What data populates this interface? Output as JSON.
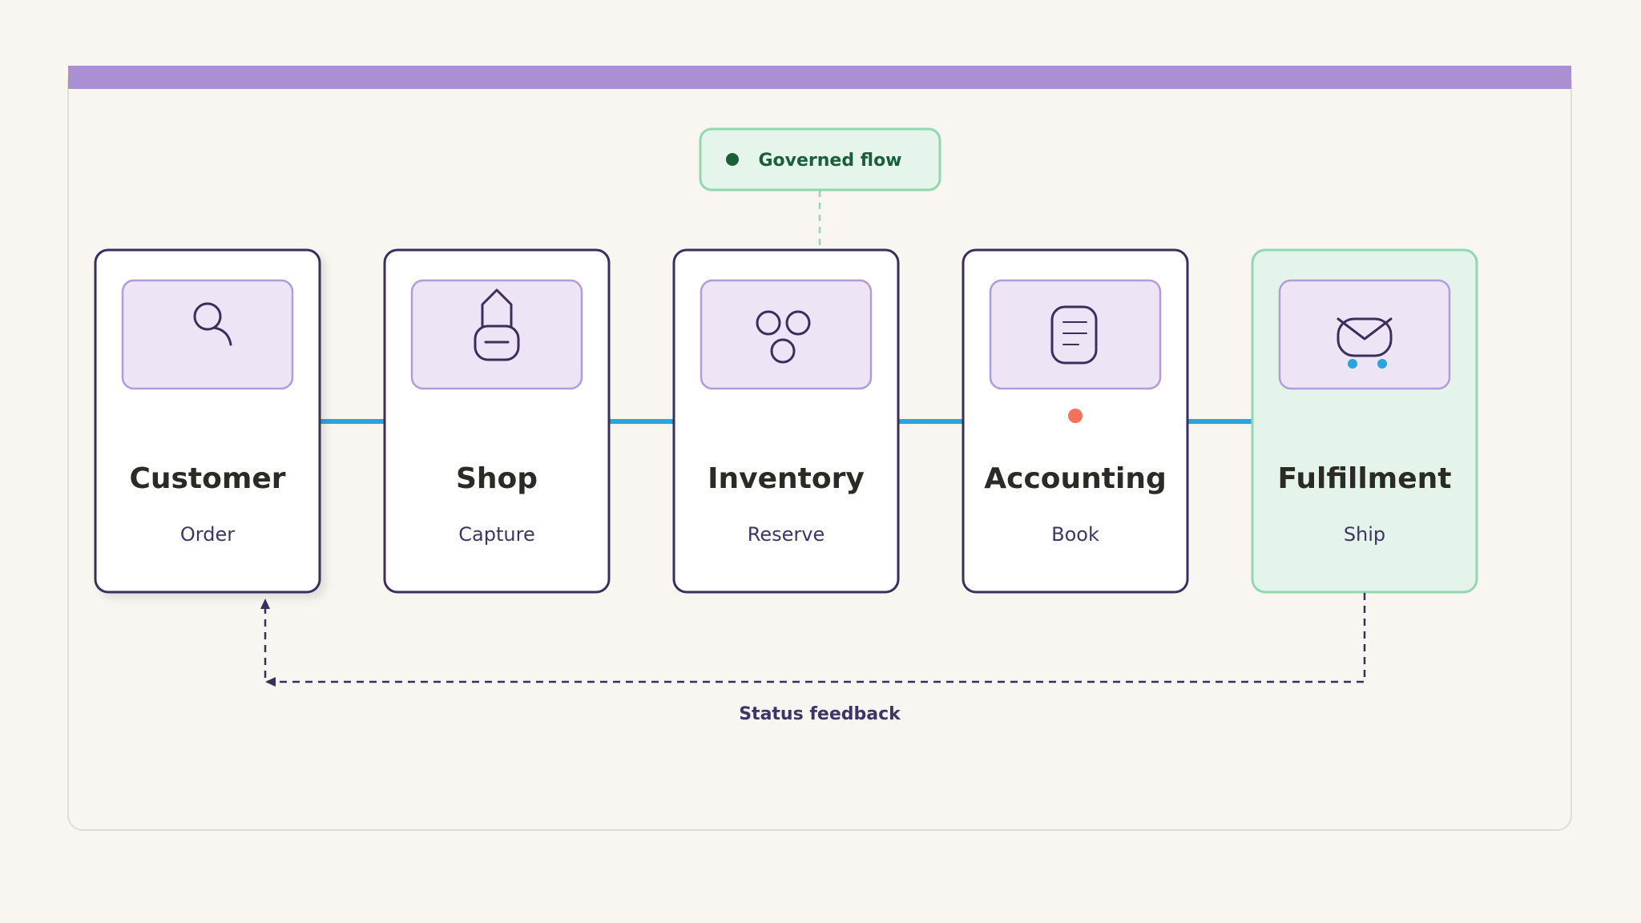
{
  "badge": {
    "label": "Governed flow",
    "dot_color": "#1b5e3a"
  },
  "stages": [
    {
      "title": "Customer",
      "subtitle": "Order",
      "icon": "user-search-icon",
      "highlighted": false
    },
    {
      "title": "Shop",
      "subtitle": "Capture",
      "icon": "shopping-bag-icon",
      "highlighted": false
    },
    {
      "title": "Inventory",
      "subtitle": "Reserve",
      "icon": "boxes-icon",
      "highlighted": false
    },
    {
      "title": "Accounting",
      "subtitle": "Book",
      "icon": "ledger-icon",
      "highlighted": false,
      "status_dot": true
    },
    {
      "title": "Fulfillment",
      "subtitle": "Ship",
      "icon": "delivery-icon",
      "highlighted": true
    }
  ],
  "feedback": {
    "label": "Status feedback"
  },
  "colors": {
    "frame_bar": "#ab8fd3",
    "connector": "#2aa3df",
    "card_border": "#3a2e5c",
    "icon_panel_fill": "#ede5f6",
    "icon_panel_border": "#b29bd9",
    "highlight_fill": "#e4f4ea",
    "highlight_border": "#8fd8b0",
    "status_dot": "#f4715a",
    "title_text": "#2c2a24",
    "subtitle_text": "#3e3566"
  }
}
